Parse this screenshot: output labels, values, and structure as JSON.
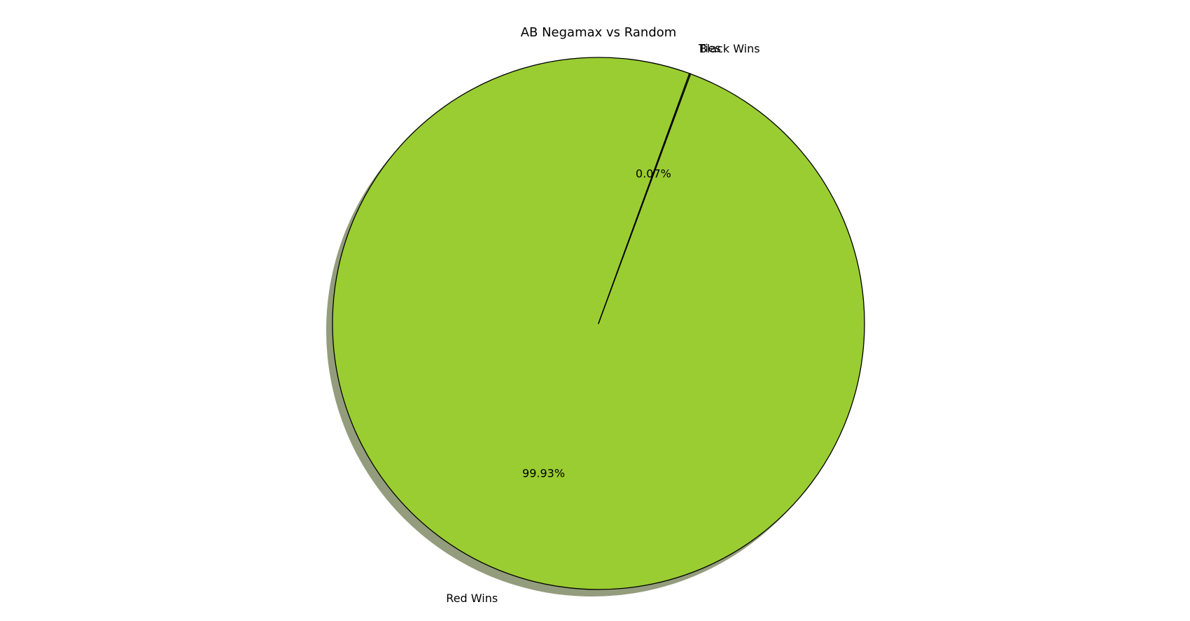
{
  "chart_data": {
    "type": "pie",
    "title": "AB Negamax vs Random",
    "slices": [
      {
        "label": "Red Wins",
        "value": 99.93,
        "pct_label": "99.93%",
        "color": "#9acd32"
      },
      {
        "label": "Black Wins",
        "value": 0.07,
        "pct_label": "0.07%",
        "color": "#9acd32"
      },
      {
        "label": "Ties",
        "value": 0.0,
        "pct_label": "",
        "color": "#9acd32"
      }
    ],
    "shadow": true,
    "shadow_color": "#939c7c",
    "edge_color": "#000000"
  }
}
